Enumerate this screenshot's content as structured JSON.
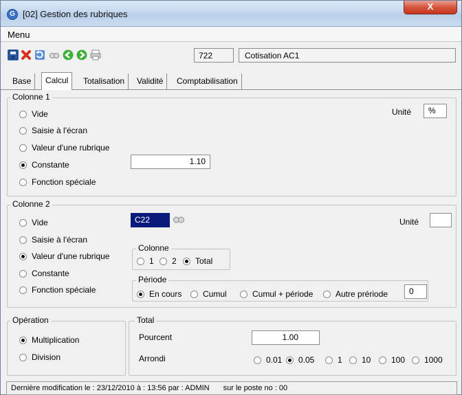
{
  "window": {
    "title": "[02]  Gestion des rubriques",
    "close_label": "X"
  },
  "menu": {
    "label": "Menu"
  },
  "toolbar": {
    "icons": [
      "save-icon",
      "delete-icon",
      "refresh-icon",
      "view-icon",
      "previous-icon",
      "next-icon",
      "print-icon"
    ],
    "code": "722",
    "label": "Cotisation AC1"
  },
  "tabs": [
    {
      "label": "Base"
    },
    {
      "label": "Calcul"
    },
    {
      "label": "Totalisation"
    },
    {
      "label": "Validité"
    },
    {
      "label": "Comptabilisation"
    }
  ],
  "colonne1": {
    "legend": "Colonne 1",
    "options": [
      "Vide",
      "Saisie à l'écran",
      "Valeur d'une rubrique",
      "Constante",
      "Fonction spéciale"
    ],
    "selected": "Constante",
    "unite_label": "Unité",
    "unite_value": "%",
    "constant_value": "1.10"
  },
  "colonne2": {
    "legend": "Colonne 2",
    "options": [
      "Vide",
      "Saisie à l'écran",
      "Valeur d'une rubrique",
      "Constante",
      "Fonction spéciale"
    ],
    "selected": "Valeur d'une rubrique",
    "rubrique_code": "C22",
    "unite_label": "Unité",
    "unite_value": "",
    "colonne_group": {
      "legend": "Colonne",
      "options": [
        "1",
        "2",
        "Total"
      ],
      "selected": "Total"
    },
    "periode_group": {
      "legend": "Période",
      "options": [
        "En cours",
        "Cumul",
        "Cumul + période",
        "Autre prériode"
      ],
      "selected": "En cours",
      "autre_value": "0"
    }
  },
  "operation": {
    "legend": "Opération",
    "options": [
      "Multiplication",
      "Division"
    ],
    "selected": "Multiplication"
  },
  "total": {
    "legend": "Total",
    "pourcent_label": "Pourcent",
    "pourcent_value": "1.00",
    "arrondi_label": "Arrondi",
    "arrondi_options": [
      "0.01",
      "0.05",
      "1",
      "10",
      "100",
      "1000"
    ],
    "arrondi_selected": "0.05"
  },
  "status": {
    "left": "Dernière modification le : 23/12/2010 à : 13:56 par : ADMIN",
    "right": "sur le poste no : 00"
  }
}
